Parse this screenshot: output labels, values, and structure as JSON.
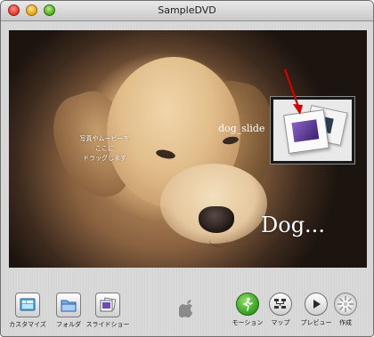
{
  "window": {
    "title": "SampleDVD"
  },
  "canvas": {
    "drop_hint_lines": [
      "写真やムービーを",
      "ここに",
      "ドラッグします"
    ],
    "drop_zone_label": "dog_slide",
    "menu_title": "Dog..."
  },
  "toolbar": {
    "left_buttons": [
      {
        "label": "カスタマイズ",
        "icon": "customize-icon"
      },
      {
        "label": "フォルダ",
        "icon": "folder-icon"
      },
      {
        "label": "スライドショー",
        "icon": "slideshow-icon"
      }
    ],
    "right_buttons": [
      {
        "label": "モーション",
        "icon": "motion-icon",
        "active": true
      },
      {
        "label": "マップ",
        "icon": "map-icon"
      },
      {
        "label": "プレビュー",
        "icon": "play-icon"
      },
      {
        "label": "作成",
        "icon": "burn-icon"
      }
    ]
  },
  "colors": {
    "motion_active": "#3fae2a",
    "drop_arrow": "#d40000",
    "canvas_bg": "#000000"
  }
}
